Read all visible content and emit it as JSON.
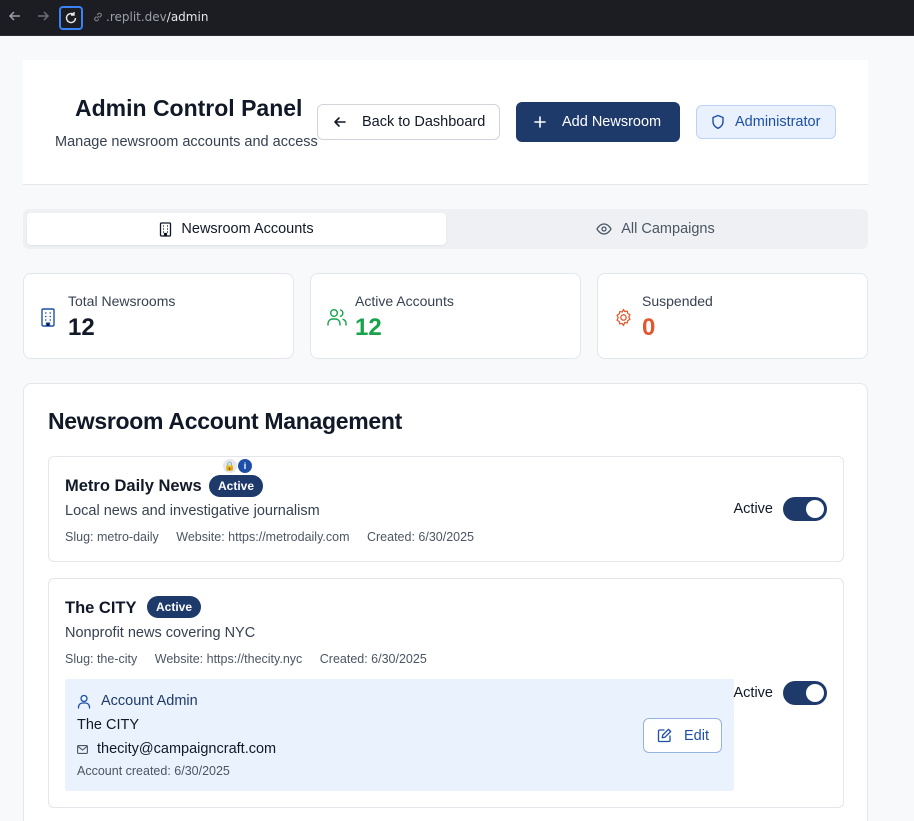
{
  "browser": {
    "url_host": ".replit.dev",
    "url_path": "/admin"
  },
  "header": {
    "title": "Admin Control Panel",
    "subtitle": "Manage newsroom accounts and access",
    "back_label": "Back to Dashboard",
    "add_label": "Add Newsroom",
    "role_label": "Administrator"
  },
  "tabs": [
    {
      "label": "Newsroom Accounts",
      "icon": "building-icon",
      "active": true
    },
    {
      "label": "All Campaigns",
      "icon": "eye-icon",
      "active": false
    }
  ],
  "stats": [
    {
      "label": "Total Newsrooms",
      "value": "12",
      "icon": "building-icon",
      "color": "#111827",
      "icon_color": "#1e4fa8"
    },
    {
      "label": "Active Accounts",
      "value": "12",
      "icon": "users-icon",
      "color": "#16a34a",
      "icon_color": "#16a34a"
    },
    {
      "label": "Suspended",
      "value": "0",
      "icon": "gear-icon",
      "color": "#e4572e",
      "icon_color": "#e4572e"
    }
  ],
  "management": {
    "title": "Newsroom Account Management",
    "accounts": [
      {
        "name": "Metro Daily News",
        "status": "Active",
        "description": "Local news and investigative journalism",
        "slug": "Slug: metro-daily",
        "website": "Website: https://metrodaily.com",
        "created": "Created: 6/30/2025",
        "toggle_label": "Active",
        "toggle_on": true
      },
      {
        "name": "The CITY",
        "status": "Active",
        "description": "Nonprofit news covering NYC",
        "slug": "Slug: the-city",
        "website": "Website: https://thecity.nyc",
        "created": "Created: 6/30/2025",
        "toggle_label": "Active",
        "toggle_on": true,
        "admin": {
          "heading": "Account Admin",
          "name": "The CITY",
          "email": "thecity@campaigncraft.com",
          "created": "Account created: 6/30/2025",
          "edit_label": "Edit"
        }
      }
    ]
  },
  "colors": {
    "primary": "#1e3a6b",
    "admin_bg": "#eaf2fd"
  }
}
